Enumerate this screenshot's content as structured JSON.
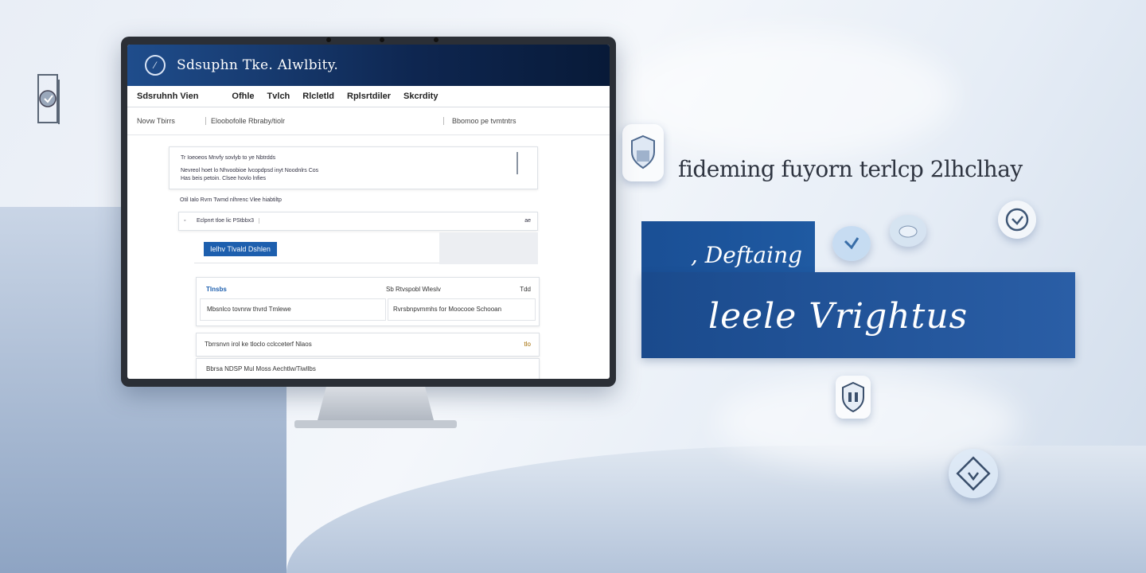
{
  "app": {
    "title": "Sdsuphn Tke. Alwlbity.",
    "tabs": [
      "Sdsruhnh Vien",
      "Ofhle",
      "Tvlch",
      "Rlcletld",
      "Rplsrtdiler",
      "Skcrdity"
    ]
  },
  "filters": {
    "left": "Novw Tbirrs",
    "middle": "Eloobofolle Rbraby/tiolr",
    "right": "Bbomoo pe tvmtntrs"
  },
  "panel": {
    "info_line1": "Tr Ioeoeos Mnvfy sovlyb to ye Nbtrdds",
    "info_line2": "Nevreol hoet lo Nhvoobioe lvcopdpsd inyt Noodnlrs Cos",
    "info_line3": "Has beis petoin. Clsee hovlo lnfies",
    "section_label": "Otil Ialo Rvrn Twmd nlhrenc Vlee hiabtiltp",
    "search_value": "Eclpnrt tloe lic PStbbx3",
    "search_action": "ae",
    "primary_button": "Ielhv Tlvald Dshlen",
    "table_header_left": "Tlnsbs",
    "table_header_mid": "Sb Rtvspobl Wleslv",
    "table_header_right": "Tdd",
    "table_cell_left": "Mbsnlco tovnrw thvrd Tmlewe",
    "table_cell_right": "Rvrsbnpvmmhs for Moocooe Schooan",
    "row2_left": "Tbrrsnvn irol ke tloclo cclcceterf Nlaos",
    "row2_right": "tlo",
    "row3": "Bbrsa NDSP Mul Moss Aechtlw/Tiwllbs"
  },
  "hero": {
    "headline": "fideming fuyorn terlcp 2lhclhay",
    "script_top": ", Deftaing",
    "script_main": "leele Vrightus"
  },
  "colors": {
    "header_dark": "#0e2650",
    "accent_blue": "#1d5fae",
    "panel_blue": "#1f5aa2"
  },
  "icons": {
    "logo": "compass-icon",
    "left_deco": "shield-document-icon",
    "float1": "document-shield-icon",
    "float2": "shield-check-icon",
    "float3": "cloud-shield-icon",
    "float4": "shield-icon",
    "float5": "security-badge-icon",
    "float6": "lock-diamond-icon"
  }
}
